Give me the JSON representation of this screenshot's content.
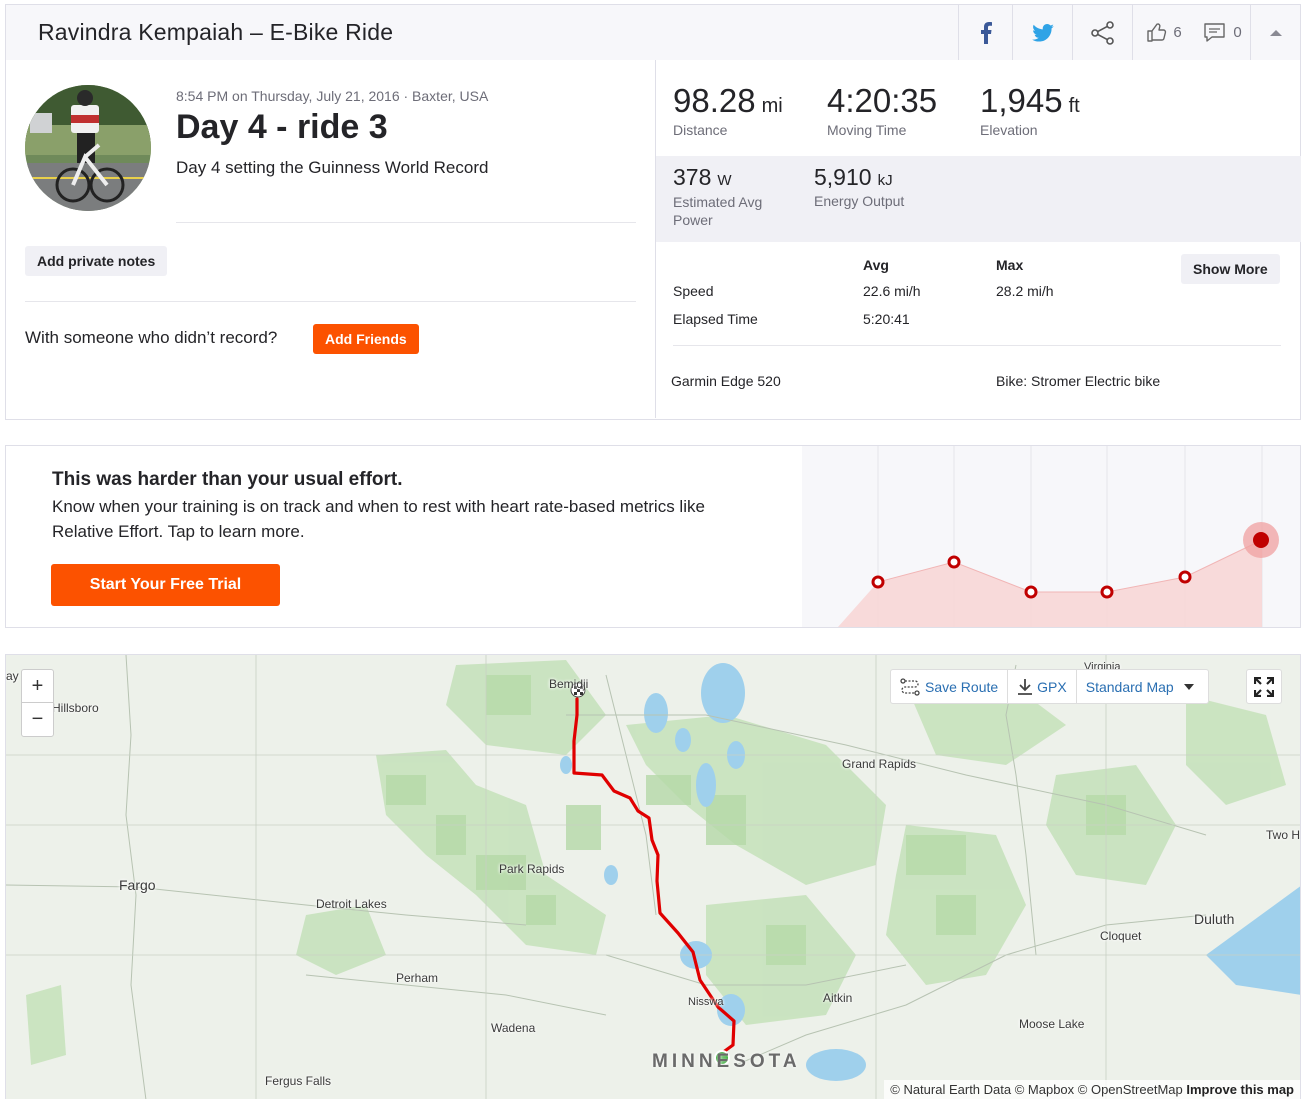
{
  "header": {
    "title": "Ravindra Kempaiah – E-Bike Ride",
    "facebook_icon": "facebook-icon",
    "twitter_icon": "twitter-icon",
    "share_icon": "share-icon",
    "kudos_count": "6",
    "comment_count": "0"
  },
  "activity": {
    "datetime": "8:54 PM on Thursday, July 21, 2016 · Baxter, USA",
    "name": "Day 4 - ride 3",
    "description": "Day 4 setting the Guinness World Record",
    "private_notes_label": "Add private notes",
    "with_someone_text": "With someone who didn’t record?",
    "add_friends_label": "Add Friends"
  },
  "stats": {
    "distance": {
      "value": "98.28",
      "unit": "mi",
      "label": "Distance"
    },
    "moving_time": {
      "value": "4:20:35",
      "label": "Moving Time"
    },
    "elevation": {
      "value": "1,945",
      "unit": "ft",
      "label": "Elevation"
    },
    "power": {
      "value": "378",
      "unit": "W",
      "label": "Estimated Avg Power"
    },
    "energy": {
      "value": "5,910",
      "unit": "kJ",
      "label": "Energy Output"
    },
    "table": {
      "avg_header": "Avg",
      "max_header": "Max",
      "speed_label": "Speed",
      "speed_avg": "22.6 mi/h",
      "speed_max": "28.2 mi/h",
      "elapsed_label": "Elapsed Time",
      "elapsed_avg": "5:20:41"
    },
    "show_more_label": "Show More",
    "device": "Garmin Edge 520",
    "bike": "Bike: Stromer Electric bike"
  },
  "effort": {
    "title": "This was harder than your usual effort.",
    "description": "Know when your training is on track and when to rest with heart rate-based metrics like Relative Effort. Tap to learn more.",
    "trial_label": "Start Your Free Trial",
    "accent": "#fc5200",
    "marker_color": "#c00000"
  },
  "map": {
    "zoom_in": "+",
    "zoom_out": "−",
    "save_route_label": "Save Route",
    "gpx_label": "GPX",
    "map_style_label": "Standard Map",
    "route_color": "#e00000",
    "start_color": "#28a428",
    "labels": {
      "hillsboro": "Hillsboro",
      "bemidji": "Bemidji",
      "virginia": "Virginia",
      "grand_rapids": "Grand Rapids",
      "two_harbors": "Two H",
      "fargo": "Fargo",
      "park_rapids": "Park Rapids",
      "detroit_lakes": "Detroit Lakes",
      "duluth": "Duluth",
      "cloquet": "Cloquet",
      "perham": "Perham",
      "nisswa": "Nisswa",
      "aitkin": "Aitkin",
      "moose_lake": "Moose Lake",
      "wadena": "Wadena",
      "fergus_falls": "Fergus Falls",
      "minnesota": "MINNESOTA",
      "ay": "ay"
    },
    "attribution_text": "© Natural Earth Data © Mapbox © OpenStreetMap",
    "improve_label": "Improve this map"
  }
}
